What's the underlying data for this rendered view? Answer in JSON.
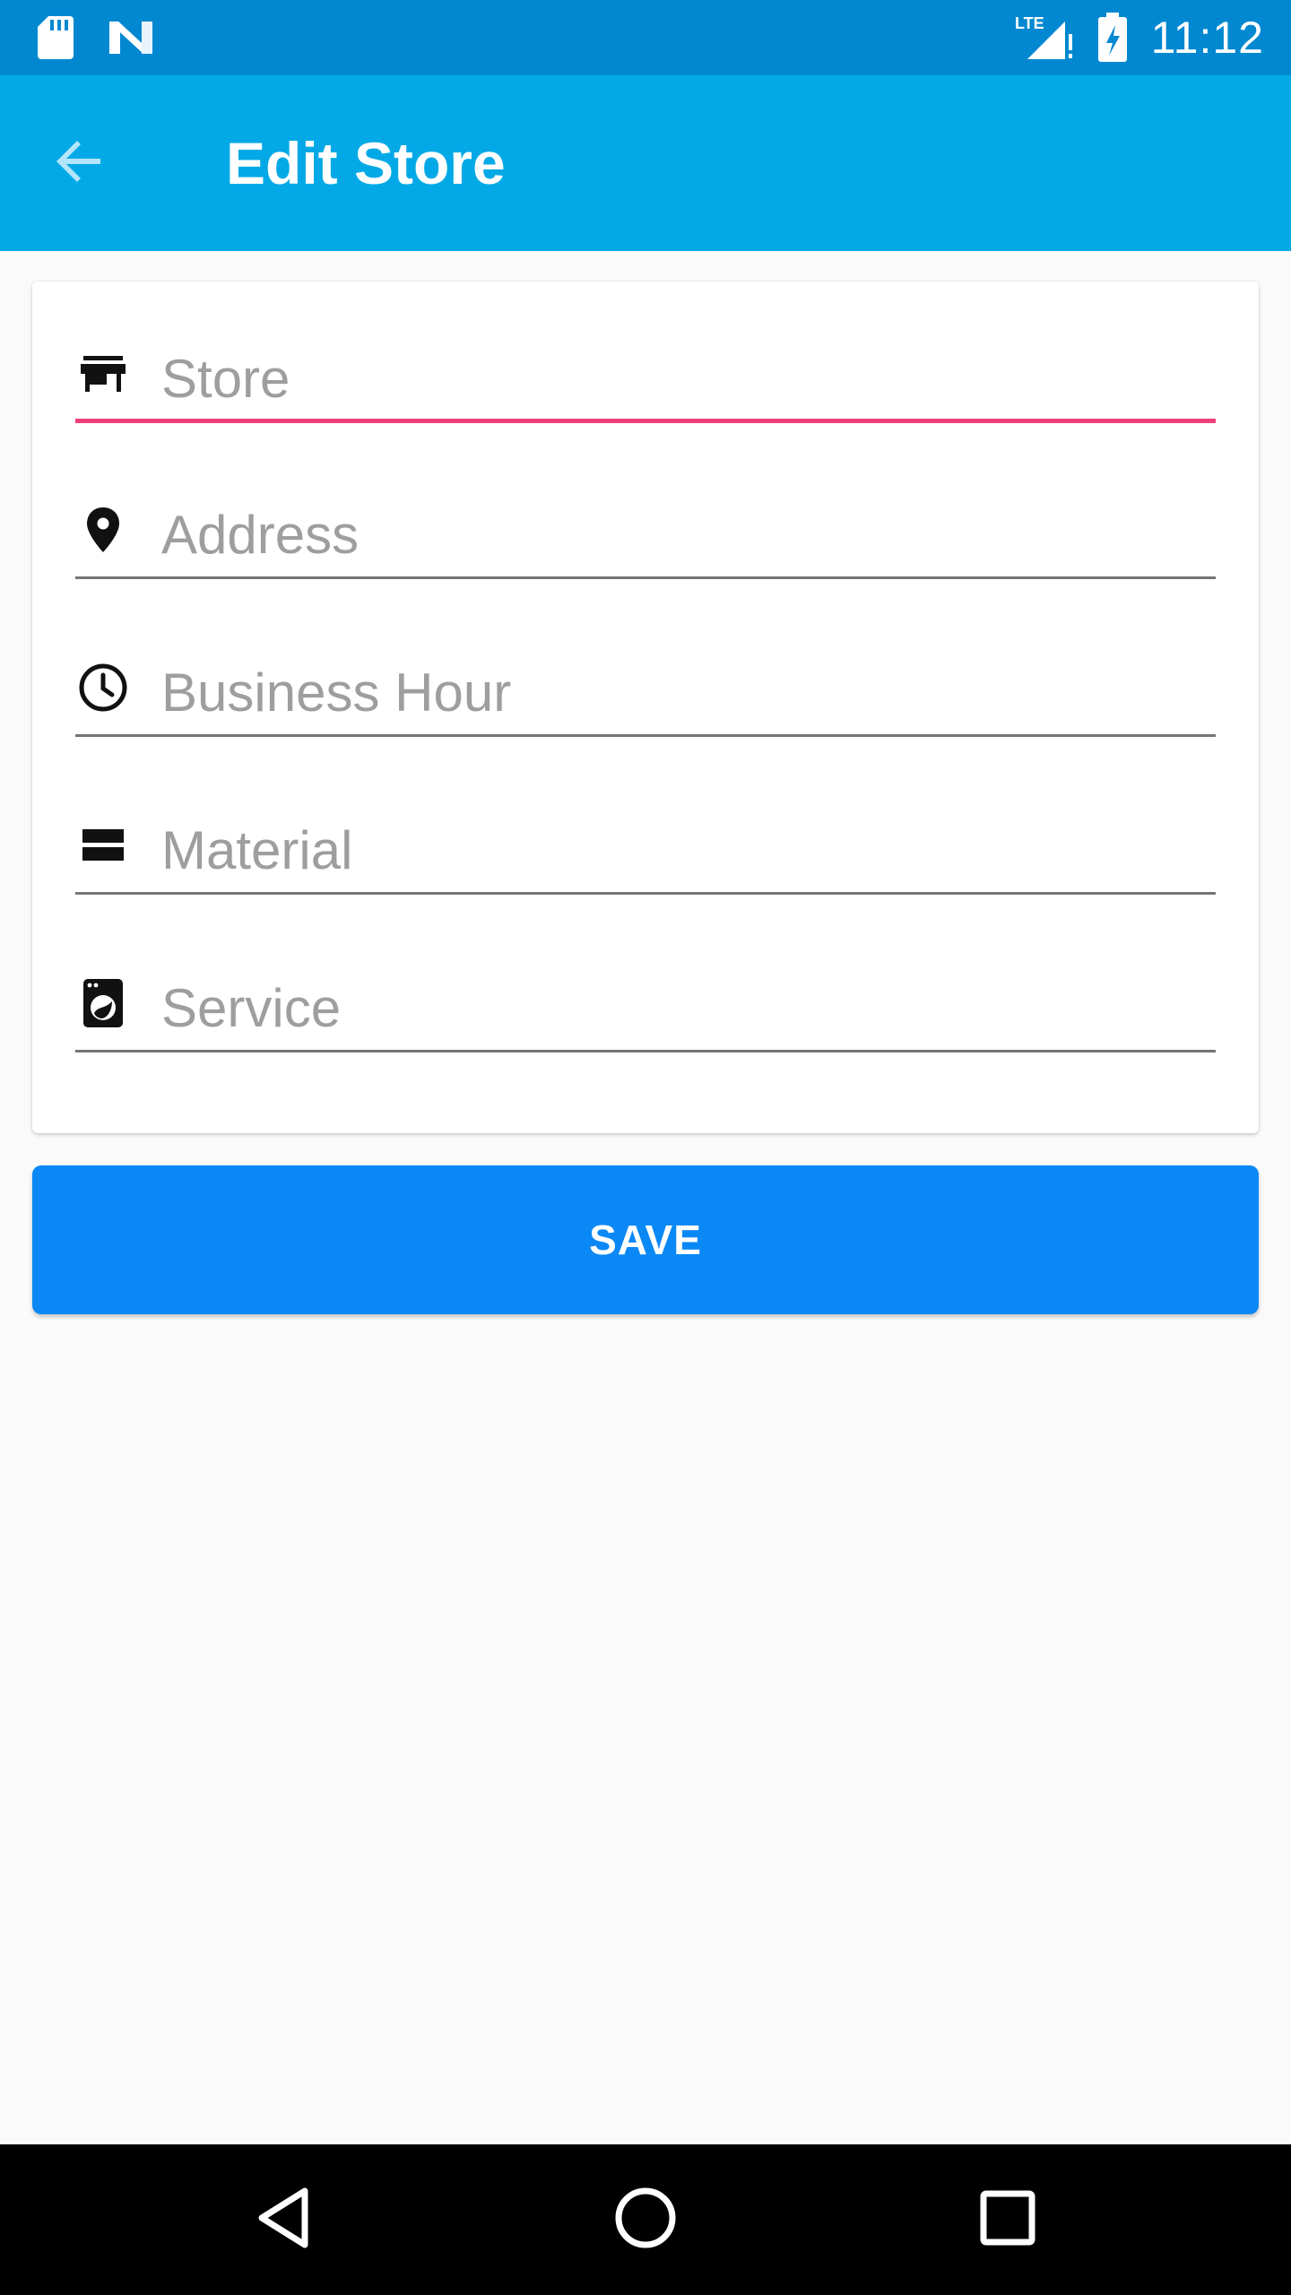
{
  "status_bar": {
    "time": "11:12",
    "icons": [
      "sd-card-icon",
      "n-logo-icon",
      "lte-signal-icon",
      "battery-charging-icon"
    ],
    "network_label": "LTE"
  },
  "app_bar": {
    "title": "Edit Store",
    "back_icon": "arrow-back-icon",
    "color": "#03a9e6"
  },
  "form": {
    "fields": [
      {
        "id": "store",
        "icon": "storefront-icon",
        "value": "",
        "placeholder": "Store",
        "active": true
      },
      {
        "id": "address",
        "icon": "location-pin-icon",
        "value": "",
        "placeholder": "Address",
        "active": false
      },
      {
        "id": "business_hour",
        "icon": "clock-icon",
        "value": "",
        "placeholder": "Business Hour",
        "active": false
      },
      {
        "id": "material",
        "icon": "material-stack-icon",
        "value": "",
        "placeholder": "Material",
        "active": false
      },
      {
        "id": "service",
        "icon": "washing-machine-icon",
        "value": "",
        "placeholder": "Service",
        "active": false
      }
    ],
    "accent_color": "#ec407a"
  },
  "save_button": {
    "label": "SAVE",
    "color": "#0a88f5"
  },
  "nav_bar": {
    "back_icon": "nav-back-triangle-icon",
    "home_icon": "nav-home-circle-icon",
    "recents_icon": "nav-recents-square-icon"
  }
}
